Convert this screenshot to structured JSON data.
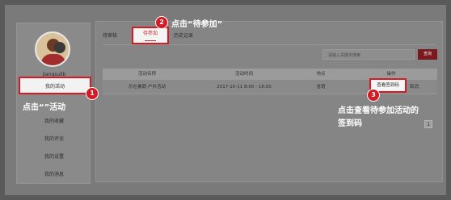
{
  "sidebar": {
    "username": "jiangsulib",
    "items": [
      {
        "label": "我的活动"
      },
      {
        "label": "我的收藏"
      },
      {
        "label": "我的评论"
      },
      {
        "label": "我的设置"
      },
      {
        "label": "我的消息"
      }
    ]
  },
  "tabs": [
    {
      "label": "待审核"
    },
    {
      "label": "待参加"
    },
    {
      "label": "历史记录"
    }
  ],
  "search": {
    "placeholder": "请输入关键字搜索",
    "button_label": "查询"
  },
  "table": {
    "headers": [
      "活动名称",
      "活动时间",
      "地点",
      "操作"
    ],
    "rows": [
      {
        "name": "乐在暑假-户外活动",
        "time": "2017-10-11 8:00 - 18:00",
        "location": "省馆",
        "action_view": "查看签到码",
        "action_cancel": "取消"
      }
    ]
  },
  "pager": {
    "current": "1"
  },
  "annotations": {
    "step1": {
      "number": "1",
      "text": "点击“”活动"
    },
    "step2": {
      "number": "2",
      "text": "点击“待参加”"
    },
    "step3": {
      "number": "3",
      "text_line1": "点击查看待参加活动的",
      "text_line2": "签到码"
    }
  },
  "colors": {
    "accent": "#d51a24",
    "button": "#7a1a1f"
  }
}
